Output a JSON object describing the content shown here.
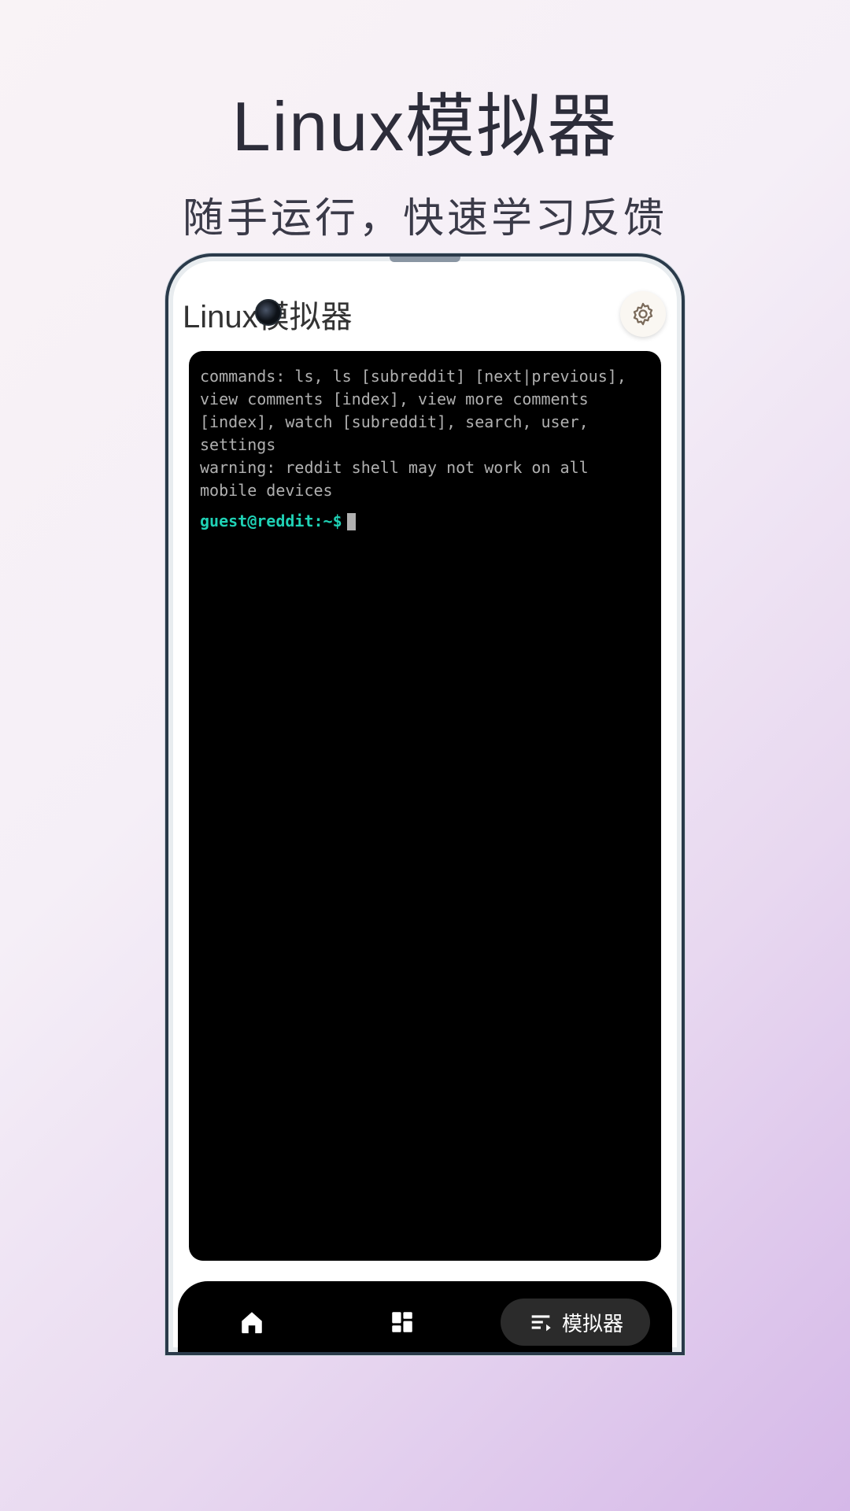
{
  "hero": {
    "title": "Linux模拟器",
    "subtitle": "随手运行，快速学习反馈"
  },
  "appBar": {
    "title": "Linux模拟器"
  },
  "terminal": {
    "commands": "commands: ls, ls [subreddit] [next|previous], view comments [index], view more comments [index], watch [subreddit], search, user, settings",
    "warning": "warning: reddit shell may not work on all mobile devices",
    "prompt": "guest@reddit:~$"
  },
  "bottomNav": {
    "emulatorLabel": "模拟器"
  }
}
